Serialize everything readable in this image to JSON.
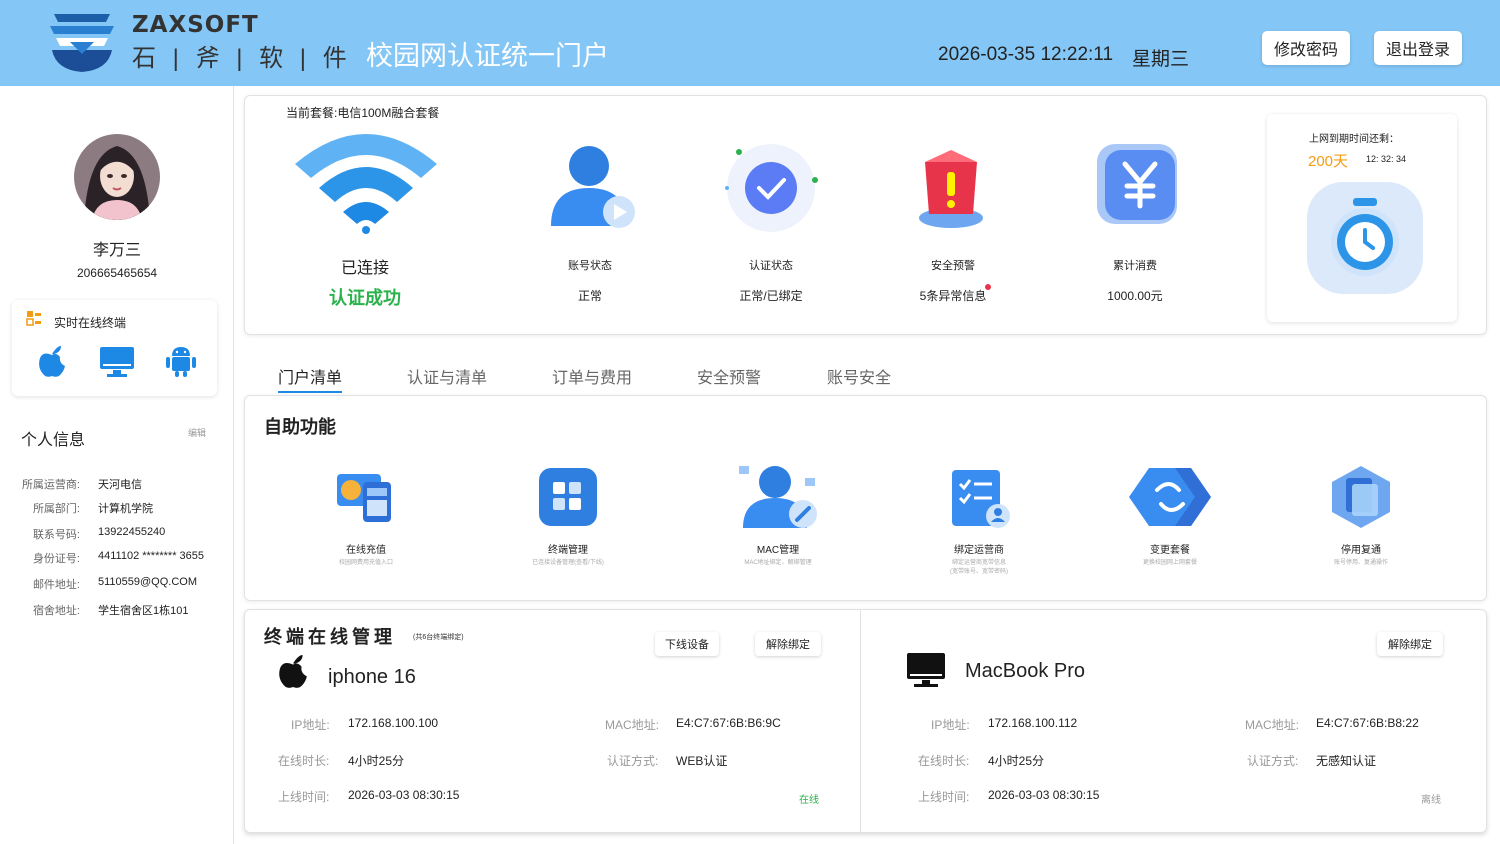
{
  "header": {
    "brand": "ZAXSOFT",
    "brand_cn": "石 | 斧 | 软 | 件",
    "portal_title": "校园网认证统一门户",
    "datetime": "2026-03-35 12:22:11",
    "weekday": "星期三",
    "change_password": "修改密码",
    "logout": "退出登录"
  },
  "user": {
    "name": "李万三",
    "id": "206665465654"
  },
  "online_terminals": {
    "title": "实时在线终端",
    "icons": [
      "apple-icon",
      "desktop-icon",
      "android-icon"
    ]
  },
  "personal_info": {
    "title": "个人信息",
    "edit": "编辑",
    "rows": [
      {
        "label": "所属运营商:",
        "value": "天河电信"
      },
      {
        "label": "所属部门:",
        "value": "计算机学院"
      },
      {
        "label": "联系号码:",
        "value": "13922455240"
      },
      {
        "label": "身份证号:",
        "value": "4411102 ******** 3655"
      },
      {
        "label": "邮件地址:",
        "value": "5110559@QQ.COM"
      },
      {
        "label": "宿舍地址:",
        "value": "学生宿舍区1栋101"
      }
    ]
  },
  "overview": {
    "package": "当前套餐:电信100M融合套餐",
    "connection": "已连接",
    "auth_result": "认证成功",
    "stats": [
      {
        "label": "账号状态",
        "value": "正常"
      },
      {
        "label": "认证状态",
        "value": "正常/已绑定"
      },
      {
        "label": "安全预警",
        "value": "5条异常信息"
      },
      {
        "label": "累计消费",
        "value": "1000.00元"
      }
    ],
    "expire": {
      "label": "上网到期时间还剩：",
      "days": "200天",
      "time": "12: 32: 34"
    }
  },
  "tabs": [
    "门户清单",
    "认证与清单",
    "订单与费用",
    "安全预警",
    "账号安全"
  ],
  "self_service": {
    "title": "自助功能",
    "items": [
      {
        "label": "在线充值",
        "desc": "校园网费用充值入口"
      },
      {
        "label": "终端管理",
        "desc": "已连接设备管理(查看/下线)"
      },
      {
        "label": "MAC管理",
        "desc": "MAC地址绑定、解绑管理"
      },
      {
        "label": "绑定运营商",
        "desc": "绑定运营商宽带信息",
        "desc2": "(宽带账号、宽带密码)"
      },
      {
        "label": "变更套餐",
        "desc": "更换校园网上网套餐"
      },
      {
        "label": "停用复通",
        "desc": "账号停用、复通操作"
      }
    ]
  },
  "terminals": {
    "title": "终端在线管理",
    "subtitle": "(共6台终端绑定)",
    "offline_button": "下线设备",
    "unbind_button": "解除绑定",
    "labels": {
      "ip": "IP地址:",
      "mac": "MAC地址:",
      "duration": "在线时长:",
      "auth": "认证方式:",
      "time": "上线时间:"
    },
    "devices": [
      {
        "name": "iphone 16",
        "ip": "172.168.100.100",
        "mac": "E4:C7:67:6B:B6:9C",
        "duration": "4小时25分",
        "auth": "WEB认证",
        "time": "2026-03-03 08:30:15",
        "status": "在线"
      },
      {
        "name": "MacBook Pro",
        "ip": "172.168.100.112",
        "mac": "E4:C7:67:6B:B8:22",
        "duration": "4小时25分",
        "auth": "无感知认证",
        "time": "2026-03-03 08:30:15",
        "status": "离线"
      }
    ]
  }
}
